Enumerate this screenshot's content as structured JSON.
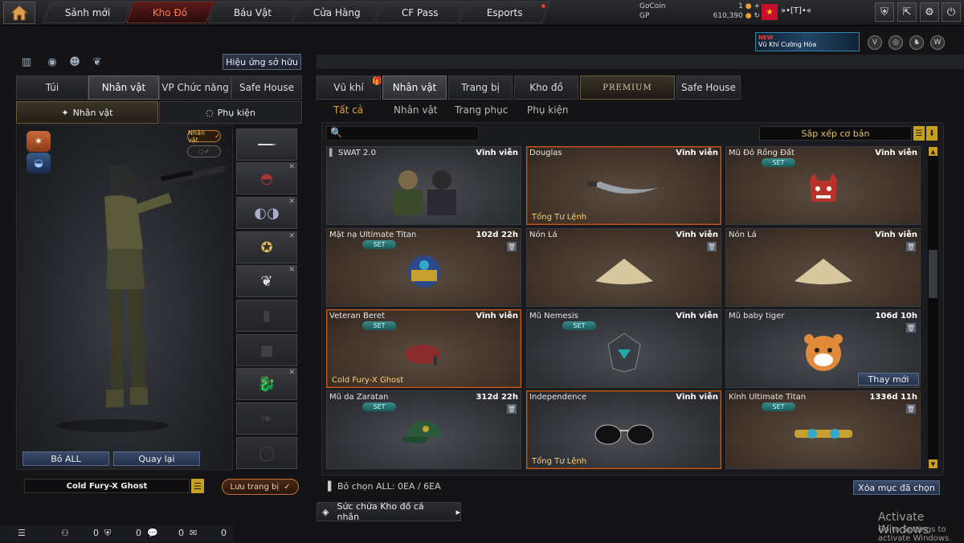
{
  "nav": {
    "tabs": [
      "Sảnh mới",
      "Kho Đồ",
      "Báu Vật",
      "Cửa Hàng",
      "CF Pass",
      "Esports"
    ],
    "active": "Kho Đồ"
  },
  "currency": {
    "gocoin_label": "GoCoin",
    "gocoin_value": "1",
    "gp_label": "GP",
    "gp_value": "610,390"
  },
  "user": {
    "name": "»•[T]•«"
  },
  "banner": {
    "new": "NEW",
    "text": "Vũ Khí Cường Hóa"
  },
  "left": {
    "effect_button": "Hiệu ứng sở hữu",
    "tabs": [
      "Túi",
      "Nhân vật",
      "VP Chức năng",
      "Safe House"
    ],
    "subtabs": [
      "Nhân vật",
      "Phụ kiện"
    ],
    "char_tag": "Nhân vật",
    "boall": "Bỏ ALL",
    "back": "Quay lại",
    "set_name": "Cold Fury-X Ghost",
    "save": "Lưu trang bị"
  },
  "right": {
    "tabs": [
      "Vũ khí",
      "Nhân vật",
      "Trang bị",
      "Kho đồ",
      "PREMIUM",
      "Safe House"
    ],
    "subtabs": [
      "Tất cả",
      "Nhân vật",
      "Trang phục",
      "Phụ kiện"
    ],
    "search_placeholder": "",
    "sort": "Sắp xếp cơ bản",
    "items": [
      {
        "name": "SWAT 2.0",
        "duration": "Vĩnh viễn",
        "footer": "",
        "set": false
      },
      {
        "name": "Douglas",
        "duration": "Vĩnh viễn",
        "footer": "Tổng Tư Lệnh",
        "set": false
      },
      {
        "name": "Mũ Đỏ Rồng Đất",
        "duration": "Vĩnh viễn",
        "footer": "",
        "set": true
      },
      {
        "name": "Mặt nạ Ultimate Titan",
        "duration": "102d 22h",
        "footer": "",
        "set": true
      },
      {
        "name": "Nón Lá",
        "duration": "Vĩnh viễn",
        "footer": "",
        "set": false
      },
      {
        "name": "Nón Lá",
        "duration": "Vĩnh viễn",
        "footer": "",
        "set": false
      },
      {
        "name": "Veteran Beret",
        "duration": "Vĩnh viễn",
        "footer": "Cold Fury-X Ghost",
        "set": true
      },
      {
        "name": "Mũ Nemesis",
        "duration": "Vĩnh viễn",
        "footer": "",
        "set": true
      },
      {
        "name": "Mũ baby tiger",
        "duration": "106d 10h",
        "footer": "",
        "set": false
      },
      {
        "name": "Mũ da Zaratan",
        "duration": "312d 22h",
        "footer": "",
        "set": true
      },
      {
        "name": "Independence",
        "duration": "Vĩnh viễn",
        "footer": "Tổng Tư Lệnh",
        "set": false
      },
      {
        "name": "Kính Ultimate Titan",
        "duration": "1336d 11h",
        "footer": "",
        "set": true
      }
    ],
    "set_label": "SET",
    "replace": "Thay mới",
    "selected": "Bỏ chọn ALL: 0EA / 6EA",
    "clear": "Xóa mục đã chọn",
    "capacity": "Sức chứa Kho đồ cá nhân"
  },
  "status": {
    "v1": "0",
    "v2": "0",
    "v3": "0",
    "v4": "0"
  },
  "windows": {
    "line1": "Activate Windows",
    "line2": "Go to Settings to activate Windows."
  }
}
